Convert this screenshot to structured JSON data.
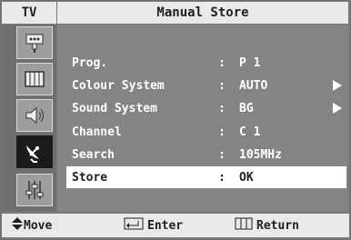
{
  "tv_tab": "TV",
  "title": "Manual Store",
  "sidebar": {
    "icons": [
      "antenna-input-icon",
      "picture-grid-icon",
      "speaker-icon",
      "satellite-dish-icon",
      "equalizer-sliders-icon"
    ],
    "active_index": 3
  },
  "rows": [
    {
      "label": "Prog.",
      "colon": ":",
      "value": "P 1",
      "has_arrow": false
    },
    {
      "label": "Colour System",
      "colon": ":",
      "value": "AUTO",
      "has_arrow": true
    },
    {
      "label": "Sound System",
      "colon": ":",
      "value": "BG",
      "has_arrow": true
    },
    {
      "label": "Channel",
      "colon": ":",
      "value": "C 1",
      "has_arrow": false
    },
    {
      "label": "Search",
      "colon": ":",
      "value": "105MHz",
      "has_arrow": false
    },
    {
      "label": "Store",
      "colon": ":",
      "value": "OK",
      "has_arrow": false,
      "selected": true
    }
  ],
  "bottom_bar": {
    "move_label": "Move",
    "enter_label": "Enter",
    "return_label": "Return"
  }
}
